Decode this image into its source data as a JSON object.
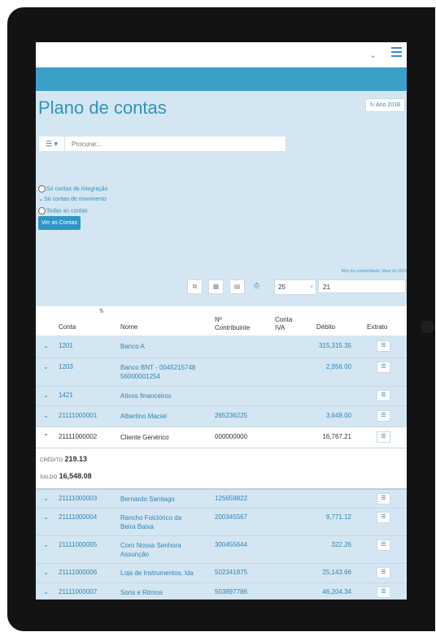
{
  "page": {
    "title": "Plano de contas",
    "year_button": "Ano 2018",
    "search_placeholder": "Procurar...",
    "filters": [
      "Só contas de integração",
      "Só contas de movimento",
      "Todas as contas"
    ],
    "show_button": "Ver as Contas",
    "accounting_month": "Mês da contabilidade: Maio de 2018",
    "page_size": "25",
    "page_number": "21"
  },
  "table": {
    "headers": {
      "conta": "Conta",
      "nome": "Nome",
      "contribuinte": "Nº Contribuinte",
      "iva": "Conta IVA",
      "debito": "Débito",
      "extrato": "Extrato"
    },
    "rows": [
      {
        "conta": "1201",
        "nome": "Banco A",
        "contribuinte": "",
        "debito": "315,315.35"
      },
      {
        "conta": "1203",
        "nome": "Banco BNT - 004521574856000001254",
        "contribuinte": "",
        "debito": "2,956.00"
      },
      {
        "conta": "1421",
        "nome": "Ativos financeiros",
        "contribuinte": "",
        "debito": ""
      },
      {
        "conta": "21111000001",
        "nome": "Albertino Maciel",
        "contribuinte": "265236225",
        "debito": "3,649.00"
      },
      {
        "conta": "21111000002",
        "nome": "Cliente Genérico",
        "contribuinte": "000000000",
        "debito": "16,767.21"
      },
      {
        "conta": "21111000003",
        "nome": "Bernardo Santiago",
        "contribuinte": "125659822",
        "debito": ""
      },
      {
        "conta": "21111000004",
        "nome": "Rancho Folclórico da Beira Baixa",
        "contribuinte": "200345567",
        "debito": "9,771.12"
      },
      {
        "conta": "21111000005",
        "nome": "Coro Nossa Senhora Assunção",
        "contribuinte": "300455644",
        "debito": "322.26"
      },
      {
        "conta": "21111000006",
        "nome": "Loja de Instrumentos, lda",
        "contribuinte": "502341875",
        "debito": "25,143.66"
      },
      {
        "conta": "21111000007",
        "nome": "Sons e Ritmos",
        "contribuinte": "503897786",
        "debito": "46,204.34"
      }
    ],
    "expanded": {
      "credito_label": "CRÉDITO",
      "credito": "219.13",
      "saldo_label": "SALDO",
      "saldo": "16,548.08"
    }
  },
  "colors": {
    "accent": "#2f94c0",
    "background": "#d4e6f1",
    "header_bar": "#3aa0c8"
  }
}
